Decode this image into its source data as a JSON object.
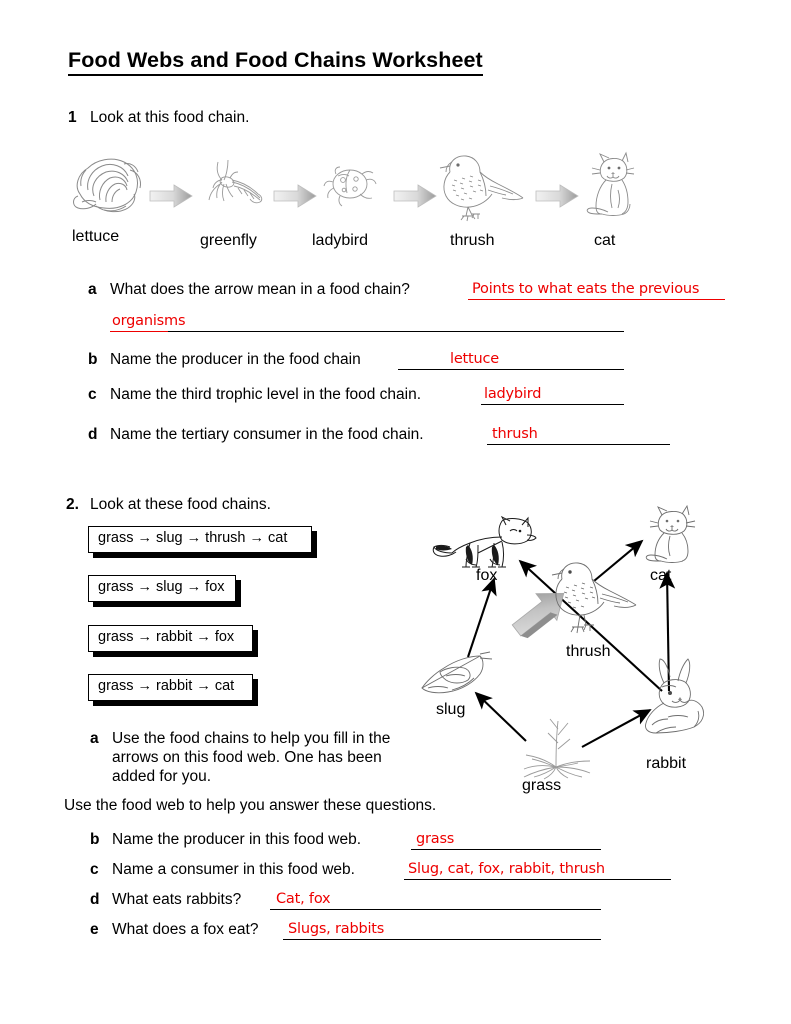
{
  "document": {
    "title": "Food Webs and Food Chains Worksheet"
  },
  "question1": {
    "number": "1",
    "prompt": "Look at this food chain.",
    "chain": [
      {
        "label": "lettuce",
        "icon": "lettuce-icon"
      },
      {
        "label": "greenfly",
        "icon": "greenfly-icon"
      },
      {
        "label": "ladybird",
        "icon": "ladybird-icon"
      },
      {
        "label": "thrush",
        "icon": "thrush-icon"
      },
      {
        "label": "cat",
        "icon": "cat-icon"
      }
    ],
    "items": [
      {
        "letter": "a",
        "text": "What does the arrow mean in a food chain?",
        "answer": "Points to what eats the previous",
        "answer_continued": "organisms"
      },
      {
        "letter": "b",
        "text": "Name the producer in the food chain",
        "answer": "lettuce"
      },
      {
        "letter": "c",
        "text": "Name the third trophic level in the food chain.",
        "answer": "ladybird"
      },
      {
        "letter": "d",
        "text": "Name the tertiary consumer in the food chain.",
        "answer": "thrush"
      }
    ]
  },
  "question2": {
    "number": "2.",
    "prompt": "Look at these food chains.",
    "chain_boxes": [
      "grass → slug → thrush → cat",
      "grass → slug → fox",
      "grass → rabbit → fox",
      "grass → rabbit → cat"
    ],
    "task_a": {
      "letter": "a",
      "line1": "Use the food chains to help you fill in the",
      "line2": "arrows on this food web. One has been",
      "line3": "added for you."
    },
    "instruction": "Use the food web to help you answer these questions.",
    "web": {
      "nodes": [
        {
          "label": "fox",
          "icon": "fox-icon"
        },
        {
          "label": "cat",
          "icon": "cat-icon"
        },
        {
          "label": "thrush",
          "icon": "thrush-icon"
        },
        {
          "label": "slug",
          "icon": "slug-icon"
        },
        {
          "label": "grass",
          "icon": "grass-icon"
        },
        {
          "label": "rabbit",
          "icon": "rabbit-icon"
        }
      ],
      "arrows": [
        {
          "from": "grass",
          "to": "slug",
          "style": "black"
        },
        {
          "from": "grass",
          "to": "rabbit",
          "style": "black"
        },
        {
          "from": "slug",
          "to": "fox",
          "style": "black"
        },
        {
          "from": "rabbit",
          "to": "fox",
          "style": "black"
        },
        {
          "from": "rabbit",
          "to": "cat",
          "style": "black"
        },
        {
          "from": "thrush",
          "to": "cat",
          "style": "black"
        },
        {
          "from": "grass",
          "to": "thrush",
          "style": "gray-preadded"
        }
      ]
    },
    "items": [
      {
        "letter": "b",
        "text": "Name the producer in this food web.",
        "answer": "grass"
      },
      {
        "letter": "c",
        "text": "Name a consumer in this food web.",
        "answer": "Slug, cat, fox, rabbit, thrush"
      },
      {
        "letter": "d",
        "text": "What eats rabbits?",
        "answer": "Cat, fox"
      },
      {
        "letter": "e",
        "text": "What does a fox eat?",
        "answer": "Slugs, rabbits"
      }
    ]
  },
  "colors": {
    "answer_red": "#ee0000",
    "rule_black": "#000000",
    "line_art": "#6e6e6e"
  }
}
